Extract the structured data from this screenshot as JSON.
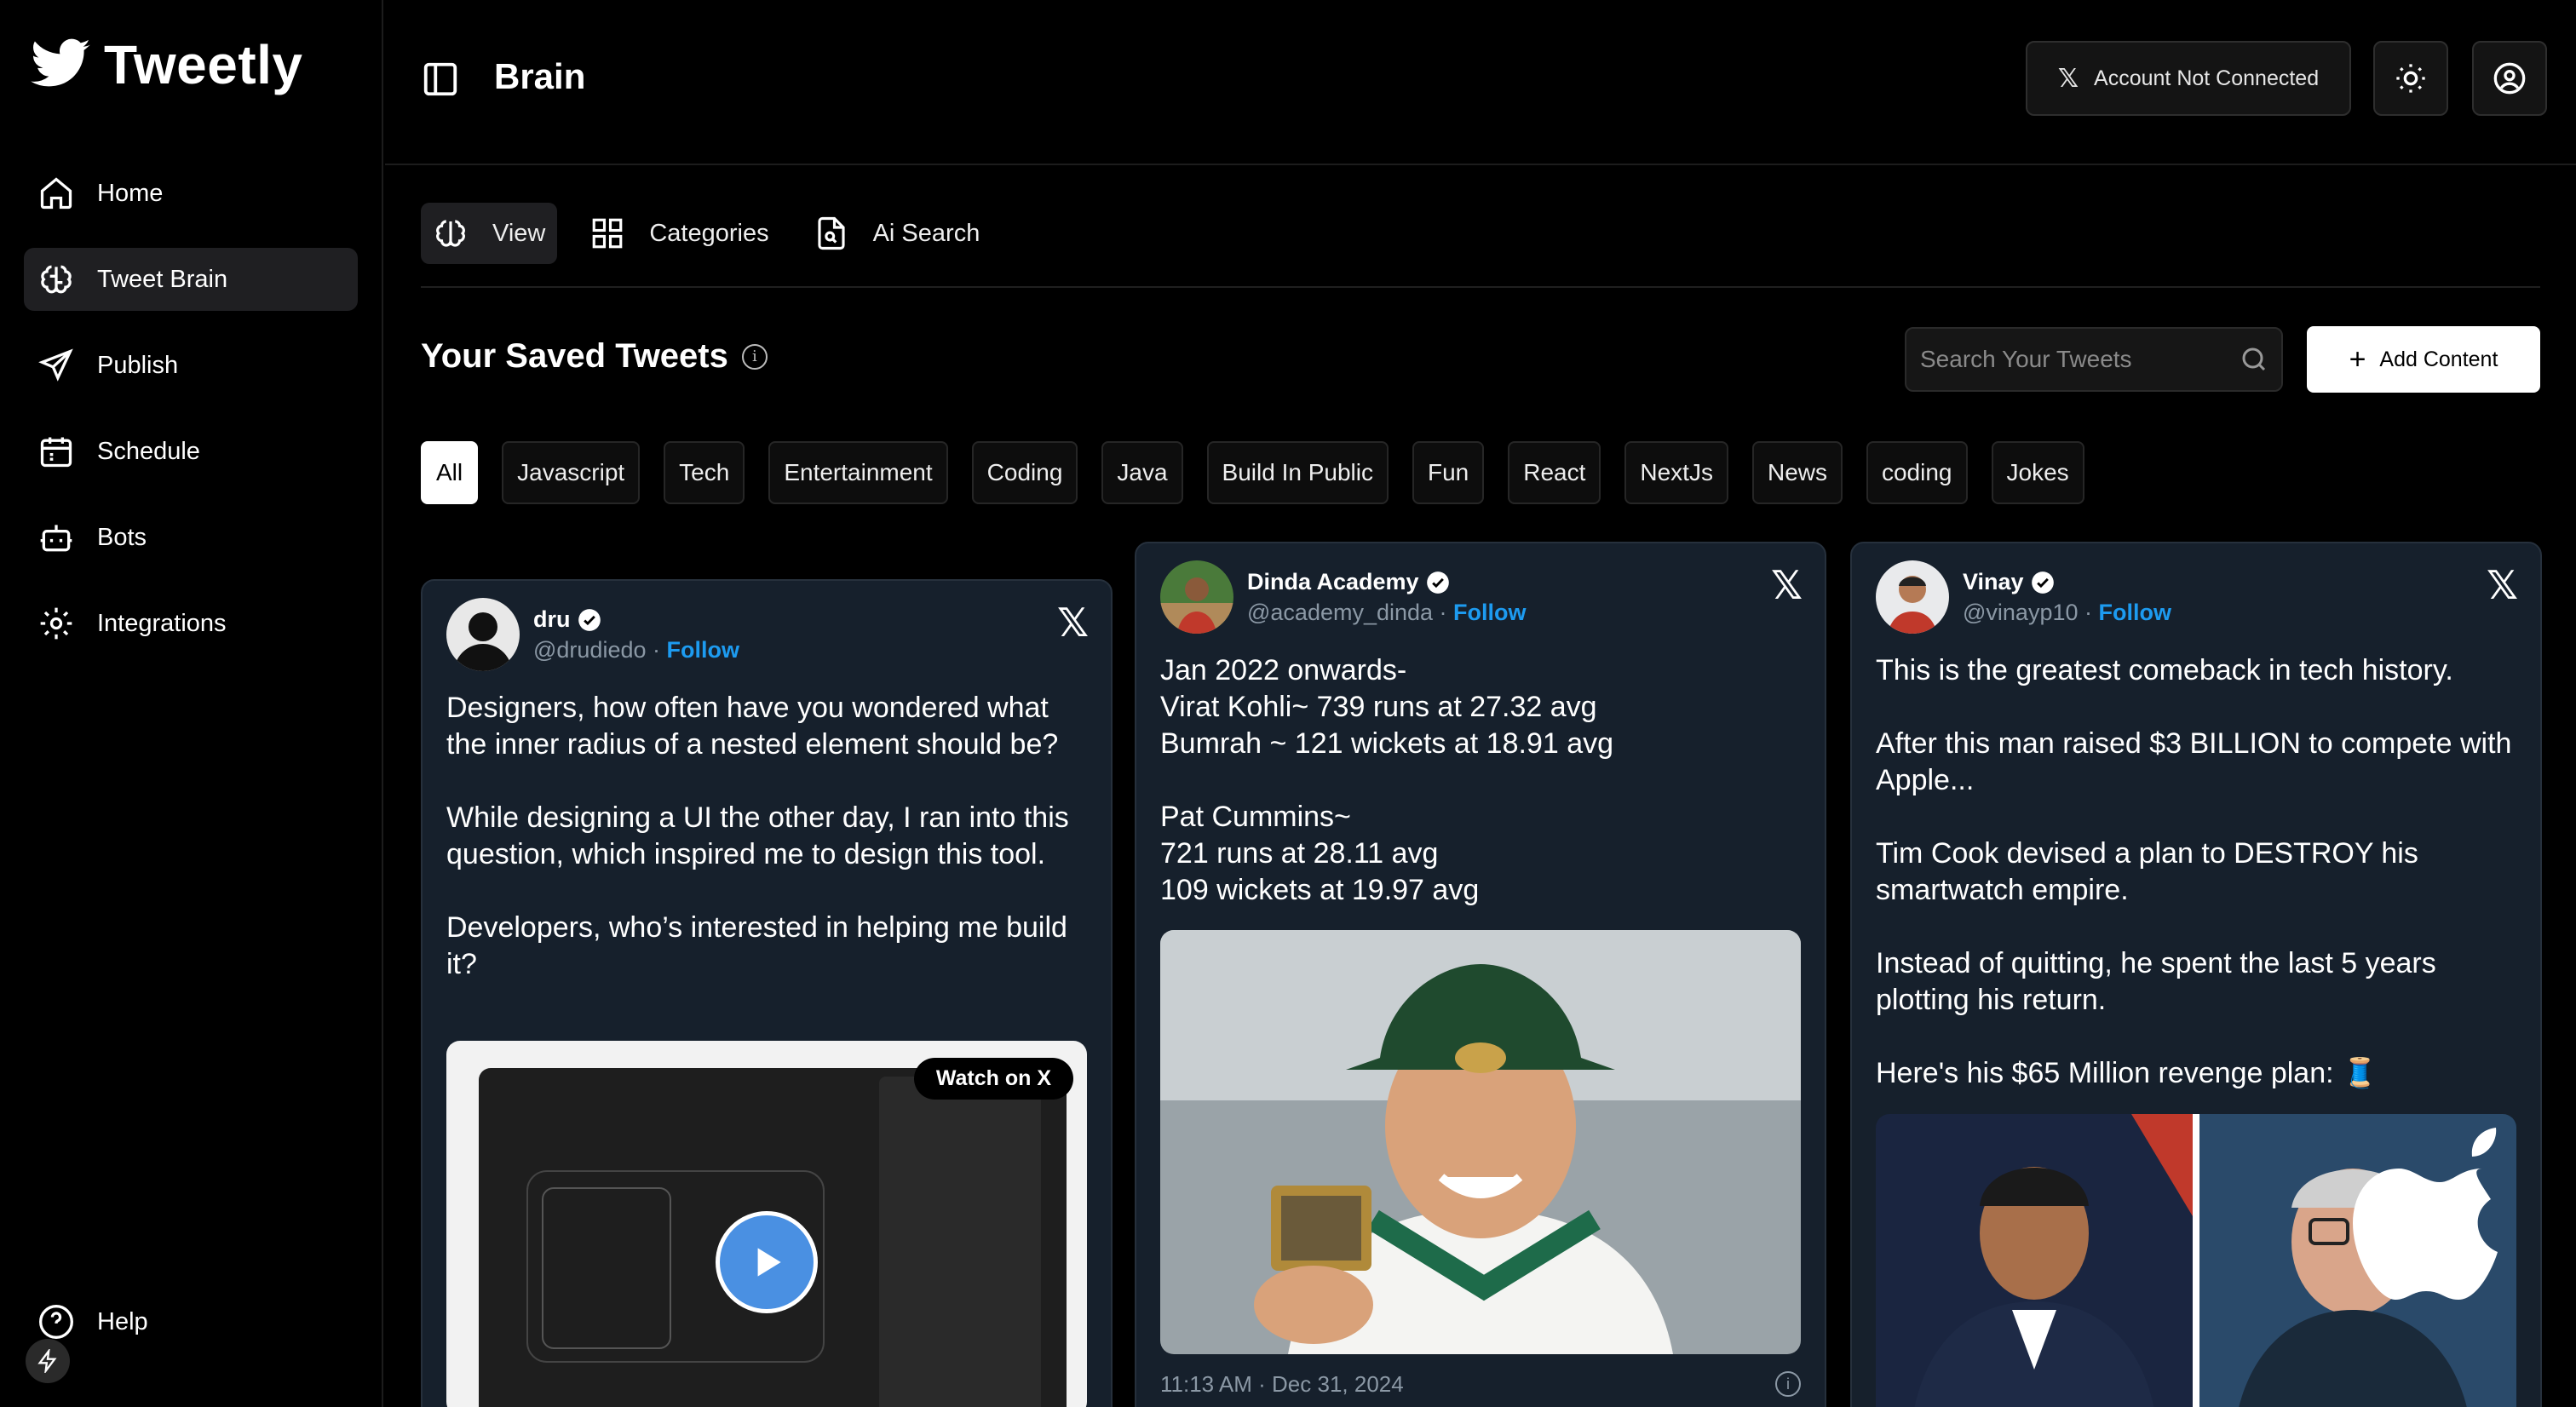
{
  "app": {
    "name": "Tweetly"
  },
  "sidebar": {
    "items": [
      {
        "label": "Home",
        "icon": "home-icon"
      },
      {
        "label": "Tweet Brain",
        "icon": "brain-icon",
        "active": true
      },
      {
        "label": "Publish",
        "icon": "send-icon"
      },
      {
        "label": "Schedule",
        "icon": "calendar-icon"
      },
      {
        "label": "Bots",
        "icon": "bot-icon"
      },
      {
        "label": "Integrations",
        "icon": "gear-icon"
      }
    ],
    "help_label": "Help"
  },
  "header": {
    "title": "Brain",
    "account_status": "Account Not Connected"
  },
  "tabs": [
    {
      "label": "View",
      "icon": "brain-icon",
      "active": true
    },
    {
      "label": "Categories",
      "icon": "grid-icon"
    },
    {
      "label": "Ai Search",
      "icon": "doc-search-icon"
    }
  ],
  "section": {
    "title": "Your Saved Tweets",
    "search_placeholder": "Search Your Tweets",
    "add_label": "Add Content"
  },
  "filters": [
    "All",
    "Javascript",
    "Tech",
    "Entertainment",
    "Coding",
    "Java",
    "Build In Public",
    "Fun",
    "React",
    "NextJs",
    "News",
    "coding",
    "Jokes"
  ],
  "active_filter": "All",
  "tweets": [
    {
      "name": "dru",
      "handle": "@drudiedo",
      "follow": "Follow",
      "text": "Designers, how often have you wondered what the inner radius of a nested element should be?\n\nWhile designing a UI the other day, I ran into this question, which inspired me to design this tool.\n\nDevelopers, who’s interested in helping me build it?",
      "media_label": "Watch on X"
    },
    {
      "name": "Dinda Academy",
      "handle": "@academy_dinda",
      "follow": "Follow",
      "text": "Jan 2022 onwards-\nVirat Kohli~ 739 runs at 27.32 avg\nBumrah ~ 121 wickets at 18.91 avg\n\nPat Cummins~\n721 runs at 28.11 avg\n109 wickets at 19.97 avg",
      "timestamp": "11:13 AM · Dec 31, 2024"
    },
    {
      "name": "Vinay",
      "handle": "@vinayp10",
      "follow": "Follow",
      "text": "This is the greatest comeback in tech history.\n\nAfter this man raised $3 BILLION to compete with Apple...\n\nTim Cook devised a plan to DESTROY his smartwatch empire.\n\nInstead of quitting, he spent the last 5 years plotting his return.\n\nHere's his $65 Million revenge plan: 🧵"
    }
  ],
  "colors": {
    "accent_link": "#1d9bf0",
    "card_bg": "#16202c",
    "verified": "#1d9bf0"
  }
}
